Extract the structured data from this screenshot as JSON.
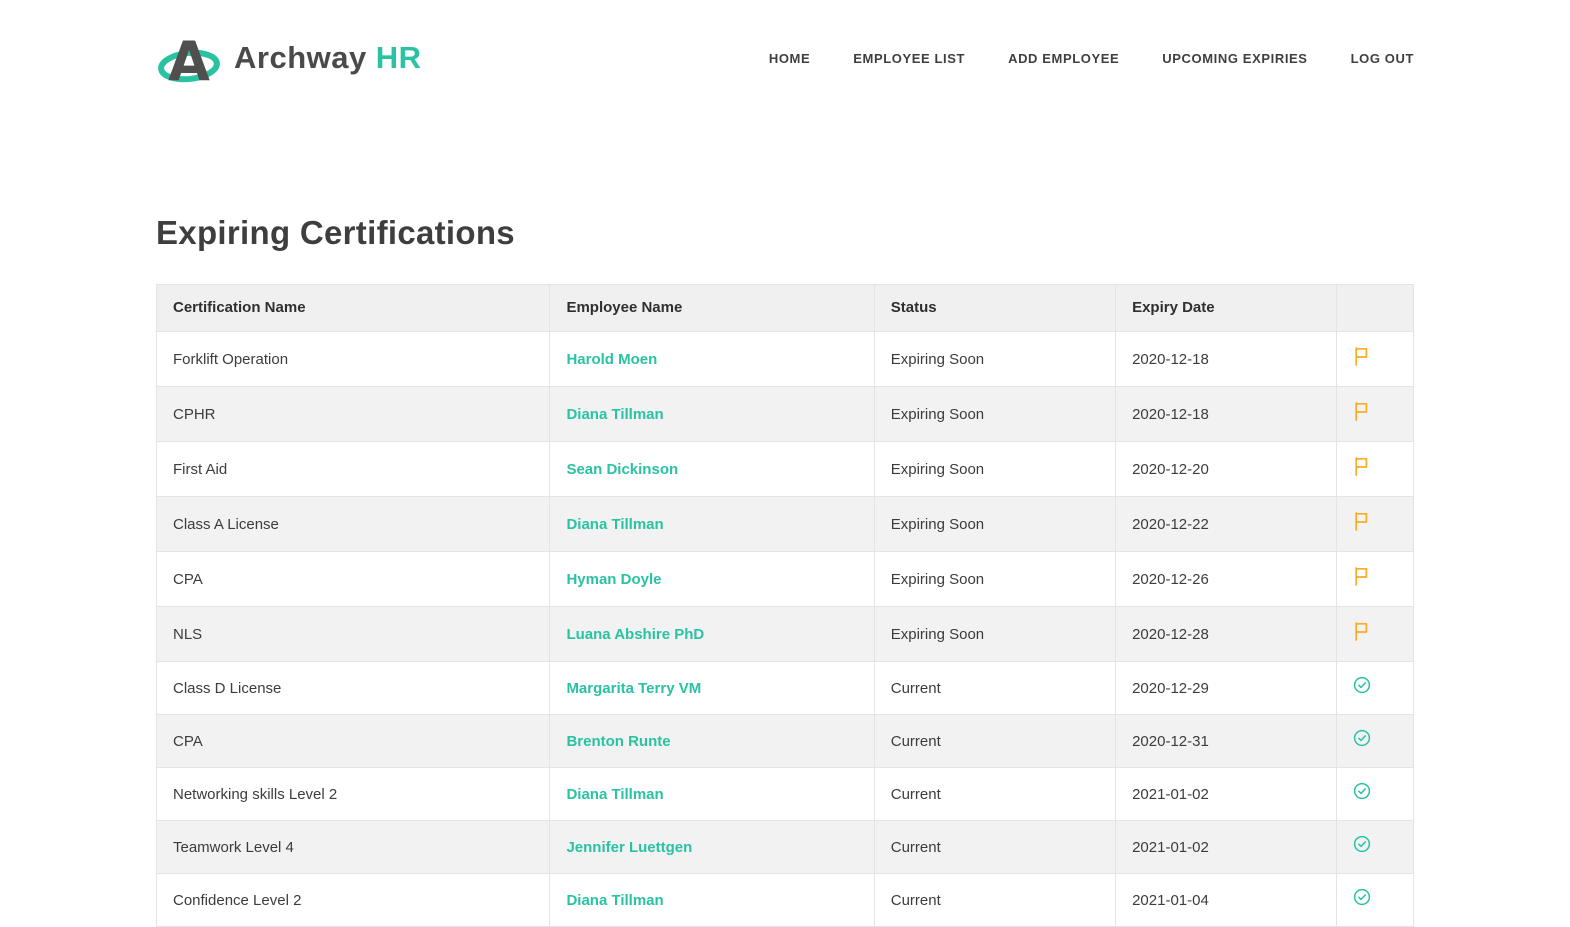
{
  "colors": {
    "accent": "#29c2a2",
    "flag": "#fbab24",
    "heading": "#3e3e3e",
    "text": "#3c3c3c",
    "nav": "#3f3f3f",
    "logo-text": "#4a4a4a",
    "table-border": "#e4e4e6",
    "row-stripe": "#f2f2f3",
    "header-bg": "#f0f0f1"
  },
  "brand": {
    "name": "Archway",
    "suffix": "HR"
  },
  "nav": {
    "items": [
      {
        "id": "home",
        "label": "HOME"
      },
      {
        "id": "employee-list",
        "label": "EMPLOYEE LIST"
      },
      {
        "id": "add-employee",
        "label": "ADD EMPLOYEE"
      },
      {
        "id": "upcoming-expiries",
        "label": "UPCOMING EXPIRIES"
      },
      {
        "id": "log-out",
        "label": "LOG OUT"
      }
    ]
  },
  "page": {
    "title": "Expiring Certifications"
  },
  "table": {
    "columns": [
      "Certification Name",
      "Employee Name",
      "Status",
      "Expiry Date",
      ""
    ],
    "rows": [
      {
        "certification": "Forklift Operation",
        "employee": "Harold Moen",
        "status": "Expiring Soon",
        "expiry": "2020-12-18",
        "icon": "flag-icon"
      },
      {
        "certification": "CPHR",
        "employee": "Diana Tillman",
        "status": "Expiring Soon",
        "expiry": "2020-12-18",
        "icon": "flag-icon"
      },
      {
        "certification": "First Aid",
        "employee": "Sean Dickinson",
        "status": "Expiring Soon",
        "expiry": "2020-12-20",
        "icon": "flag-icon"
      },
      {
        "certification": "Class A License",
        "employee": "Diana Tillman",
        "status": "Expiring Soon",
        "expiry": "2020-12-22",
        "icon": "flag-icon"
      },
      {
        "certification": "CPA",
        "employee": "Hyman Doyle",
        "status": "Expiring Soon",
        "expiry": "2020-12-26",
        "icon": "flag-icon"
      },
      {
        "certification": "NLS",
        "employee": "Luana Abshire PhD",
        "status": "Expiring Soon",
        "expiry": "2020-12-28",
        "icon": "flag-icon"
      },
      {
        "certification": "Class D License",
        "employee": "Margarita Terry VM",
        "status": "Current",
        "expiry": "2020-12-29",
        "icon": "check-circle-icon"
      },
      {
        "certification": "CPA",
        "employee": "Brenton Runte",
        "status": "Current",
        "expiry": "2020-12-31",
        "icon": "check-circle-icon"
      },
      {
        "certification": "Networking skills Level 2",
        "employee": "Diana Tillman",
        "status": "Current",
        "expiry": "2021-01-02",
        "icon": "check-circle-icon"
      },
      {
        "certification": "Teamwork Level 4",
        "employee": "Jennifer Luettgen",
        "status": "Current",
        "expiry": "2021-01-02",
        "icon": "check-circle-icon"
      },
      {
        "certification": "Confidence Level 2",
        "employee": "Diana Tillman",
        "status": "Current",
        "expiry": "2021-01-04",
        "icon": "check-circle-icon"
      }
    ]
  }
}
